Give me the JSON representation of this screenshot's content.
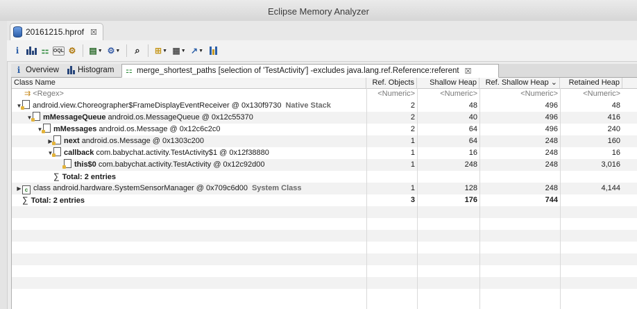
{
  "window": {
    "title": "Eclipse Memory Analyzer"
  },
  "file_tab": {
    "label": "20161215.hprof",
    "close": "☒"
  },
  "toolbar": {
    "items": [
      {
        "name": "info-icon",
        "glyph": "i"
      },
      {
        "name": "histogram-icon",
        "glyph": "bars"
      },
      {
        "name": "dominator-tree-icon",
        "glyph": "⚏"
      },
      {
        "name": "oql-icon",
        "glyph": "OQL"
      },
      {
        "name": "heap-dump-overview-icon",
        "glyph": "⚙"
      },
      {
        "name": "run-report-icon",
        "glyph": "▤",
        "dropdown": true
      },
      {
        "name": "query-browser-icon",
        "glyph": "⚙",
        "dropdown": true
      },
      {
        "name": "search-icon",
        "glyph": "🔍"
      },
      {
        "name": "group-by-icon",
        "glyph": "⊞",
        "dropdown": true
      },
      {
        "name": "calculate-retained-icon",
        "glyph": "▦",
        "dropdown": true
      },
      {
        "name": "export-icon",
        "glyph": "↗",
        "dropdown": true
      },
      {
        "name": "compare-icon",
        "glyph": "▮"
      }
    ]
  },
  "view_tabs": [
    {
      "label": "Overview",
      "icon": "info-icon"
    },
    {
      "label": "Histogram",
      "icon": "histogram-icon"
    },
    {
      "label": "merge_shortest_paths [selection of 'TestActivity'] -excludes java.lang.ref.Reference:referent",
      "icon": "tree-icon",
      "close": "☒"
    }
  ],
  "columns": [
    "Class Name",
    "Ref. Objects",
    "Shallow Heap",
    "Ref. Shallow Heap",
    "Retained Heap"
  ],
  "sort_indicator": "⌄",
  "filter_row": {
    "class": "<Regex>",
    "ref_objects": "<Numeric>",
    "shallow": "<Numeric>",
    "ref_shallow": "<Numeric>",
    "retained": "<Numeric>"
  },
  "rows": [
    {
      "indent": 0,
      "toggle": "▼",
      "icon": "object",
      "bold_part": "",
      "text": "android.view.Choreographer$FrameDisplayEventReceiver @ 0x130f9730",
      "tag": "Native Stack",
      "ref": "2",
      "shallow": "48",
      "ref_shallow": "496",
      "retained": "48"
    },
    {
      "indent": 1,
      "toggle": "▼",
      "icon": "object",
      "bold_part": "mMessageQueue",
      "text": "android.os.MessageQueue @ 0x12c55370",
      "tag": "",
      "ref": "2",
      "shallow": "40",
      "ref_shallow": "496",
      "retained": "416"
    },
    {
      "indent": 2,
      "toggle": "▼",
      "icon": "object",
      "bold_part": "mMessages",
      "text": "android.os.Message @ 0x12c6c2c0",
      "tag": "",
      "ref": "2",
      "shallow": "64",
      "ref_shallow": "496",
      "retained": "240"
    },
    {
      "indent": 3,
      "toggle": "▶",
      "icon": "object",
      "bold_part": "next",
      "text": "android.os.Message @ 0x1303c200",
      "tag": "",
      "ref": "1",
      "shallow": "64",
      "ref_shallow": "248",
      "retained": "160"
    },
    {
      "indent": 3,
      "toggle": "▼",
      "icon": "object",
      "bold_part": "callback",
      "text": "com.babychat.activity.TestActivity$1 @ 0x12f38880",
      "tag": "",
      "ref": "1",
      "shallow": "16",
      "ref_shallow": "248",
      "retained": "16"
    },
    {
      "indent": 4,
      "toggle": "",
      "icon": "object",
      "bold_part": "this$0",
      "text": "com.babychat.activity.TestActivity @ 0x12c92d00",
      "tag": "",
      "ref": "1",
      "shallow": "248",
      "ref_shallow": "248",
      "retained": "3,016"
    },
    {
      "indent": 3,
      "toggle": "",
      "icon": "sum",
      "bold_part": "Total: 2 entries",
      "text": "",
      "tag": "",
      "ref": "",
      "shallow": "",
      "ref_shallow": "",
      "retained": ""
    },
    {
      "indent": 0,
      "toggle": "▶",
      "icon": "class",
      "bold_part": "",
      "text": "class android.hardware.SystemSensorManager @ 0x709c6d00",
      "tag": "System Class",
      "ref": "1",
      "shallow": "128",
      "ref_shallow": "248",
      "retained": "4,144"
    },
    {
      "indent": 0,
      "toggle": "",
      "icon": "sum",
      "bold_part": "Total: 2 entries",
      "text": "",
      "tag": "",
      "ref": "3",
      "shallow": "176",
      "ref_shallow": "744",
      "retained": "",
      "bold_nums": true
    }
  ]
}
